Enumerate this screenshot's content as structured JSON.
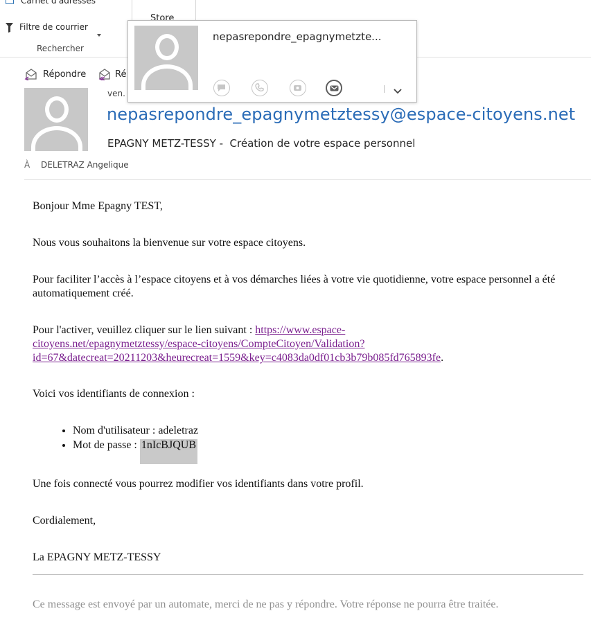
{
  "ribbon": {
    "address_book_label": "Carnet d'adresses",
    "filter_label": "Filtre de courrier",
    "group_label": "Rechercher",
    "store_label": "Store"
  },
  "actions": {
    "reply_label": "Répondre",
    "reply_all_label": "Ré"
  },
  "contact_card": {
    "name": "nepasrepondre_epagnymetzte..."
  },
  "message": {
    "date_partial": "ven.",
    "sender": "nepasrepondre_epagnymetztessy@espace-citoyens.net",
    "subject": "EPAGNY METZ-TESSY -  Création de votre espace personnel",
    "to_label": "À",
    "to": "DELETRAZ Angelique"
  },
  "body": {
    "greeting": "Bonjour Mme Epagny TEST,",
    "welcome": "Nous vous souhaitons la bienvenue sur votre espace citoyens.",
    "intro": "Pour faciliter l’accès à l’espace citoyens et à vos démarches liées à votre vie quotidienne, votre espace personnel a été automatiquement créé.",
    "activate_prefix": "Pour l'activer, veuillez cliquer sur le lien suivant : ",
    "activation_link": "https://www.espace-citoyens.net/epagnymetztessy/espace-citoyens/CompteCitoyen/Validation?id=67&datecreat=20211203&heurecreat=1559&key=c4083da0df01cb3b79b085fd765893fe",
    "activation_link_line1": "https://www.espace-",
    "activation_link_line2": "citoyens.net/epagnymetztessy/espace-citoyens/CompteCitoyen/Validation?",
    "activation_link_line3": "id=67&datecreat=20211203&heurecreat=1559&key=c4083da0df01cb3b79b085fd765893fe",
    "activate_suffix": ".",
    "credentials_intro": "Voici vos identifiants de connexion :",
    "username_label": "Nom d'utilisateur : ",
    "username": "adeletraz",
    "password_label": "Mot de passe : ",
    "password": "1nIcBJQUB",
    "profile_note": "Une fois connecté vous pourrez modifier vos identifiants dans votre profil.",
    "closing": "Cordialement,",
    "signature": "La EPAGNY METZ-TESSY",
    "footer_note": "Ce message est envoyé par un automate, merci de ne pas y répondre. Votre réponse ne pourra être traitée."
  },
  "colors": {
    "sender_link": "#2b6cb7",
    "body_link": "#7a1f8e",
    "avatar_bg": "#c8c8c8",
    "password_highlight": "#c9c9c9",
    "footer_text": "#909090"
  }
}
